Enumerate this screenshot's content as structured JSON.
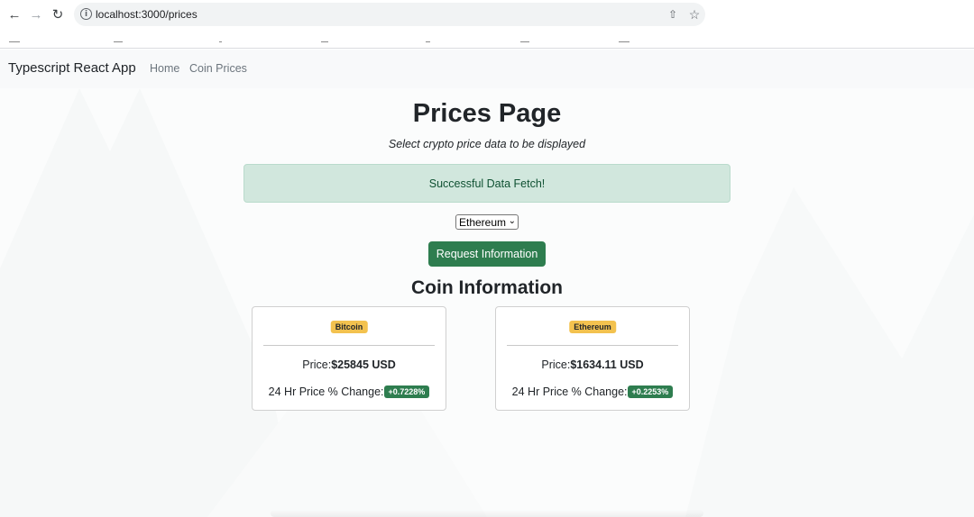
{
  "browser": {
    "url": "localhost:3000/prices"
  },
  "navbar": {
    "brand": "Typescript React App",
    "links": [
      {
        "label": "Home"
      },
      {
        "label": "Coin Prices"
      }
    ]
  },
  "main": {
    "title": "Prices Page",
    "subtitle": "Select crypto price data to be displayed",
    "alert": "Successful Data Fetch!",
    "select": {
      "selected": "Ethereum"
    },
    "request_button": "Request Information",
    "section_title": "Coin Information",
    "cards": [
      {
        "coin": "Bitcoin",
        "price_label": "Price:",
        "price_value": "$25845 USD",
        "change_label": "24 Hr Price % Change:",
        "change_value": "+0.7228%"
      },
      {
        "coin": "Ethereum",
        "price_label": "Price:",
        "price_value": "$1634.11 USD",
        "change_label": "24 Hr Price % Change:",
        "change_value": "+0.2253%"
      }
    ]
  },
  "colors": {
    "alert_bg": "#d1e7dd",
    "button": "#2e7d4f",
    "coin_badge": "#f3c24f",
    "navbar_bg": "#f8f9fa"
  }
}
